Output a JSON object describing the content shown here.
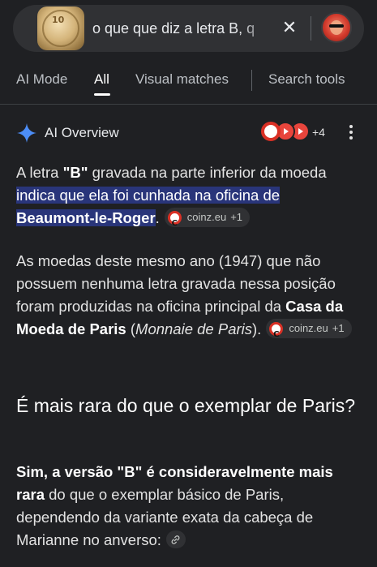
{
  "search": {
    "query": "o que que diz a letra B, q",
    "clear_label": "✕"
  },
  "tabs": [
    {
      "label": "AI Mode"
    },
    {
      "label": "All",
      "active": true
    },
    {
      "label": "Visual matches"
    },
    {
      "label": "Search tools"
    }
  ],
  "overview": {
    "title": "AI Overview",
    "source_count": "+4",
    "p1": {
      "t1": "A letra ",
      "b1": "\"B\"",
      "t2": " gravada na parte inferior da moeda ",
      "hl1": "indica que ela foi cunhada na oficina de ",
      "hlb": "Beaumont-le-Roger",
      "t3": ".",
      "chip_source": "coinz.eu",
      "chip_more": "+1"
    },
    "p2": {
      "t1": "As moedas deste mesmo ano (1947) que não possuem nenhuma letra gravada nessa posição foram produzidas na oficina principal da ",
      "b1": "Casa da Moeda de Paris",
      "t2": " (",
      "i1": "Monnaie de Paris",
      "t3": ").",
      "chip_source": "coinz.eu",
      "chip_more": "+1"
    },
    "heading": "É mais rara do que o exemplar de Paris?",
    "p3": {
      "b1": "Sim, a versão \"B\" é consideravelmente mais rara",
      "t1": " do que o exemplar básico de Paris, dependendo da variante exata da cabeça de Marianne no anverso:"
    }
  },
  "icons": {
    "thumbnail": "coin-image",
    "clear": "close-icon",
    "avatar": "user-avatar",
    "spark": "sparkle-icon",
    "more": "more-vert-icon",
    "link": "link-icon"
  },
  "colors": {
    "background": "#1f2023",
    "highlight": "#29357a",
    "spark_blue": "#4c8df6"
  }
}
